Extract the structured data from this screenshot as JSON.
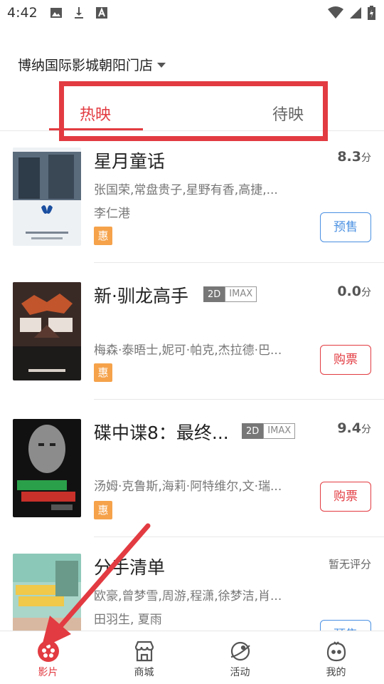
{
  "status_bar": {
    "time": "4:42",
    "left_icons": [
      "image-icon",
      "download-icon",
      "font-icon"
    ],
    "right_icons": [
      "wifi-icon",
      "signal-icon",
      "battery-icon"
    ]
  },
  "cinema": {
    "name": "博纳国际影城朝阳门店"
  },
  "tabs": [
    {
      "label": "热映",
      "active": true
    },
    {
      "label": "待映",
      "active": false
    }
  ],
  "movies": [
    {
      "title": "星月童话",
      "score": "8.3",
      "score_unit": "分",
      "cast": "张国荣,常盘贵子,星野有香,高捷,...",
      "director": "李仁港",
      "discount_badge": "惠",
      "button": "预售",
      "badges": []
    },
    {
      "title": "新·驯龙高手",
      "score": "0.0",
      "score_unit": "分",
      "cast": "梅森·泰晤士,妮可·帕克,杰拉德·巴...",
      "discount_badge": "惠",
      "button": "购票",
      "badges": [
        "2D",
        "IMAX"
      ]
    },
    {
      "title": "碟中谍8：最终...",
      "score": "9.4",
      "score_unit": "分",
      "cast": "汤姆·克鲁斯,海莉·阿特维尔,文·瑞...",
      "discount_badge": "惠",
      "button": "购票",
      "badges": [
        "2D",
        "IMAX"
      ]
    },
    {
      "title": "分手清单",
      "score_text": "暂无评分",
      "cast": "欧豪,曾梦雪,周游,程潇,徐梦洁,肖...",
      "director": "田羽生, 夏雨",
      "button": "预售"
    }
  ],
  "bottom_nav": [
    {
      "label": "影片",
      "icon": "film-reel-icon",
      "active": true
    },
    {
      "label": "商城",
      "icon": "store-icon",
      "active": false
    },
    {
      "label": "活动",
      "icon": "planet-icon",
      "active": false
    },
    {
      "label": "我的",
      "icon": "smiley-face-icon",
      "active": false
    }
  ],
  "colors": {
    "accent": "#e23b41",
    "presale": "#4a90e2",
    "discount": "#f5a24a",
    "annotation": "#e23b41"
  }
}
